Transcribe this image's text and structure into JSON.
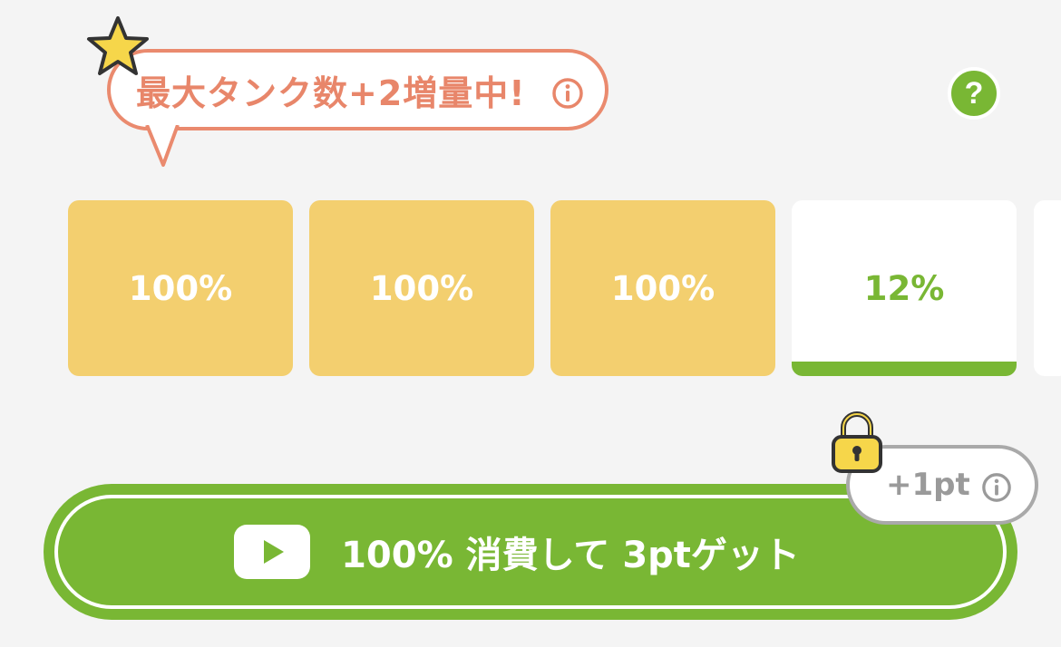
{
  "banner": {
    "text": "最大タンク数+2増量中!",
    "accent_color": "#ea8a6e",
    "decoration_icon": "star-icon",
    "info_icon": "info-circle-icon"
  },
  "help": {
    "label": "?",
    "color": "#79b734"
  },
  "tanks": [
    {
      "label": "100%",
      "level": 1.0,
      "state": "full"
    },
    {
      "label": "100%",
      "level": 1.0,
      "state": "full"
    },
    {
      "label": "100%",
      "level": 1.0,
      "state": "full"
    },
    {
      "label": "12%",
      "level": 0.12,
      "state": "filling"
    }
  ],
  "colors": {
    "tank_full": "#f3cf6f",
    "tank_empty": "#ffffff",
    "fill_green": "#79b734",
    "background": "#f4f4f4"
  },
  "action": {
    "label": "100% 消費して 3ptゲット",
    "icon": "video-play-icon",
    "color": "#79b734"
  },
  "bonus": {
    "label": "+1pt",
    "icon": "lock-icon",
    "info_icon": "info-circle-icon",
    "locked": true
  }
}
